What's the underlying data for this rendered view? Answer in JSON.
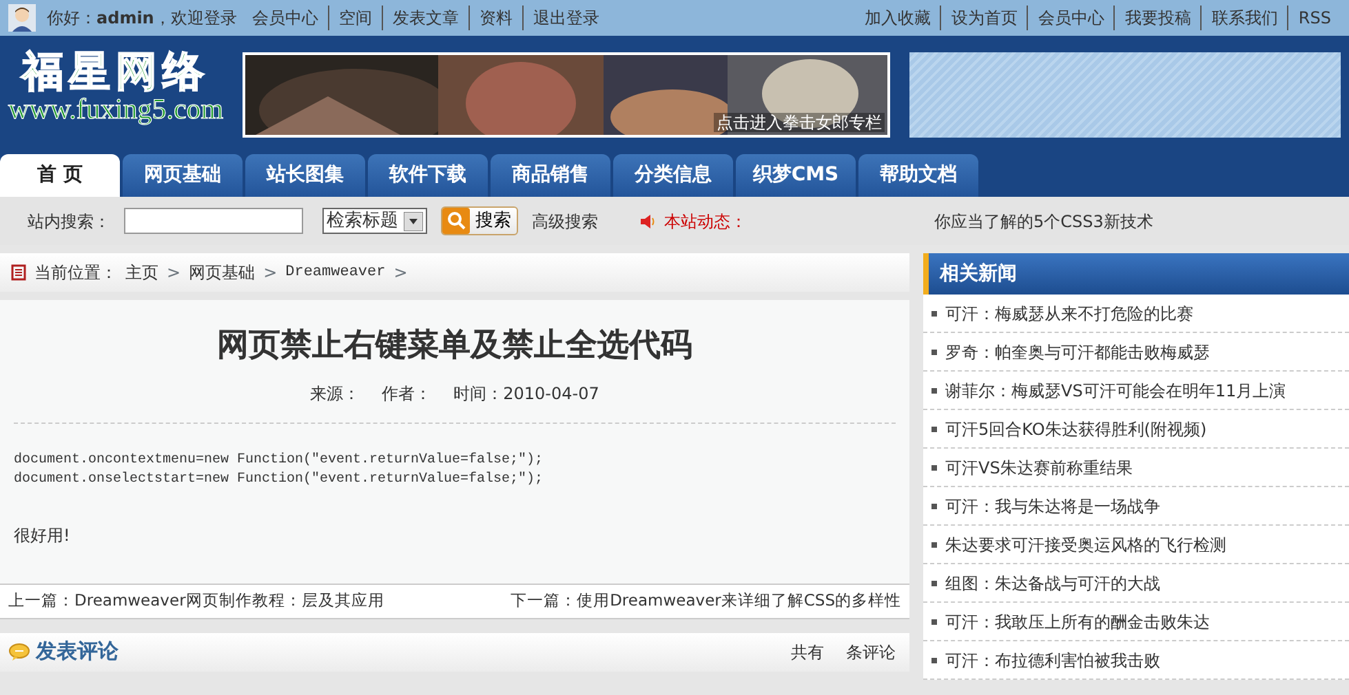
{
  "top_bar": {
    "greeting": "你好：**admin**，欢迎登录",
    "user_links": [
      "会员中心",
      "空间",
      "发表文章",
      "资料",
      "退出登录"
    ],
    "site_links": [
      "加入收藏",
      "设为首页",
      "会员中心",
      "我要投稿",
      "联系我们",
      "RSS"
    ]
  },
  "header": {
    "logo_title": "福星网络",
    "logo_url": "www.fuxing5.com",
    "banner": {
      "kind": "picture",
      "caption": "点击进入拳击女郎专栏"
    }
  },
  "nav_tabs": [
    {
      "label": "首 页",
      "selected": true
    },
    {
      "label": "网页基础",
      "selected": false
    },
    {
      "label": "站长图集",
      "selected": false
    },
    {
      "label": "软件下载",
      "selected": false
    },
    {
      "label": "商品销售",
      "selected": false
    },
    {
      "label": "分类信息",
      "selected": false
    },
    {
      "label": "织梦CMS",
      "selected": false
    },
    {
      "label": "帮助文档",
      "selected": false
    }
  ],
  "search": {
    "label": "站内搜索：",
    "scope": "检索标题",
    "button": "搜索",
    "advanced": "高级搜索",
    "news_label": "本站动态：",
    "news_item": "你应当了解的5个CSS3新技术"
  },
  "breadcrumb": {
    "label": "当前位置：",
    "items": [
      "主页",
      "网页基础",
      "Dreamweaver"
    ],
    "separator": ">"
  },
  "article": {
    "title": "网页禁止右键菜单及禁止全选代码",
    "meta": [
      "来源：",
      "作者：",
      "时间：2010-04-07"
    ],
    "code_lines": [
      "document.oncontextmenu=new Function(\"event.returnValue=false;\");",
      "document.onselectstart=new Function(\"event.returnValue=false;\");"
    ],
    "body": "很好用!",
    "previous": "上一篇：Dreamweaver网页制作教程：层及其应用",
    "next": "下一篇：使用Dreamweaver来详细了解CSS的多样性"
  },
  "comments": {
    "title": "发表评论",
    "count_prefix": "共有",
    "count_suffix": "条评论"
  },
  "related_news": {
    "title": "相关新闻",
    "items": [
      "可汗：梅威瑟从来不打危险的比赛",
      "罗奇：帕奎奥与可汗都能击败梅威瑟",
      "谢菲尔：梅威瑟VS可汗可能会在明年11月上演",
      "可汗5回合KO朱达获得胜利(附视频)",
      "可汗VS朱达赛前称重结果",
      "可汗：我与朱达将是一场战争",
      "朱达要求可汗接受奥运风格的飞行检测",
      "组图：朱达备战与可汗的大战",
      "可汗：我敢压上所有的酬金击败朱达",
      "可汗：布拉德利害怕被我击败"
    ]
  }
}
